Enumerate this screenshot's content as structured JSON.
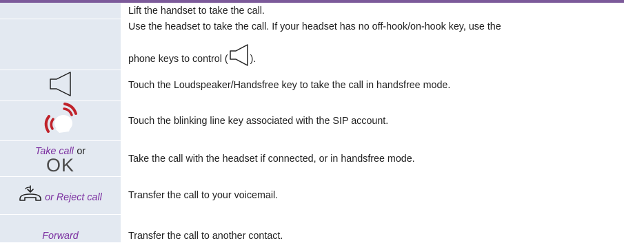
{
  "rows": [
    {
      "key": "",
      "text": "Lift the handset to take the call."
    },
    {
      "key": "",
      "text_part1": "Use the headset to take the call. If your headset has no off-hook/on-hook key, use the",
      "text_part2": "phone keys to control (",
      "text_part3": ").",
      "inline_icon": "loudspeaker-icon"
    },
    {
      "key_icon": "loudspeaker-icon",
      "text": "Touch the Loudspeaker/Handsfree key to take the call in handsfree mode."
    },
    {
      "key_icon": "line-key-ringing-icon",
      "text": "Touch the blinking line key associated with the SIP account."
    },
    {
      "key_softkey": "Take call",
      "key_or": "or",
      "key_ok": "OK",
      "text": "Take the call with the headset if connected, or in handsfree mode."
    },
    {
      "key_icon": "transfer-voicemail-icon",
      "key_softkey": "or Reject call",
      "text": "Transfer the call to your voicemail."
    },
    {
      "key_softkey": "Forward",
      "text": "Transfer the call to another contact."
    }
  ],
  "colors": {
    "accent_line": "#7c5a9a",
    "softkey_text": "#7b2fa0",
    "key_cell_bg": "#e3e9f1",
    "ringing_red": "#c0232b"
  }
}
